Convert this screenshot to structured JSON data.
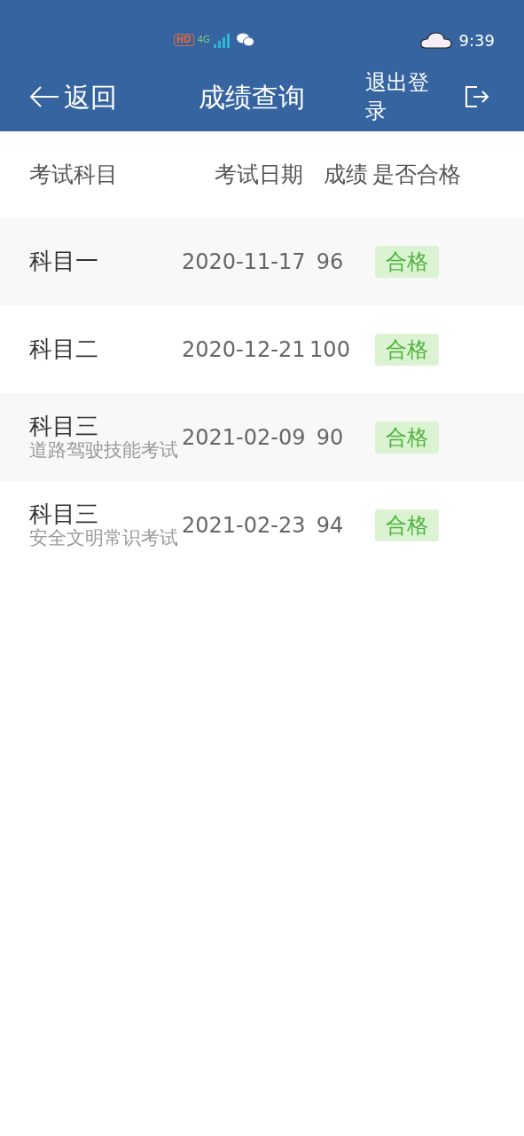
{
  "status_bar": {
    "indicators": [
      "HD",
      "4G"
    ],
    "time": "9:39"
  },
  "header": {
    "back": "返回",
    "title": "成绩查询",
    "logout": "退出登录"
  },
  "table": {
    "columns": [
      "考试科目",
      "考试日期",
      "成绩",
      "是否合格"
    ],
    "rows": [
      {
        "subject": "科目一",
        "date": "2020-11-17",
        "score": "96",
        "result": "合格",
        "passed": true
      },
      {
        "subject": "科目二",
        "date": "2020-12-21",
        "score": "100",
        "result": "合格",
        "passed": true
      },
      {
        "subject": "科目三",
        "detail": "道路驾驶技能考试",
        "date": "2021-02-09",
        "score": "90",
        "result": "合格",
        "passed": true
      },
      {
        "subject": "科目三",
        "detail": "安全文明常识考试",
        "date": "2021-02-23",
        "score": "94",
        "result": "合格",
        "passed": true
      }
    ]
  }
}
